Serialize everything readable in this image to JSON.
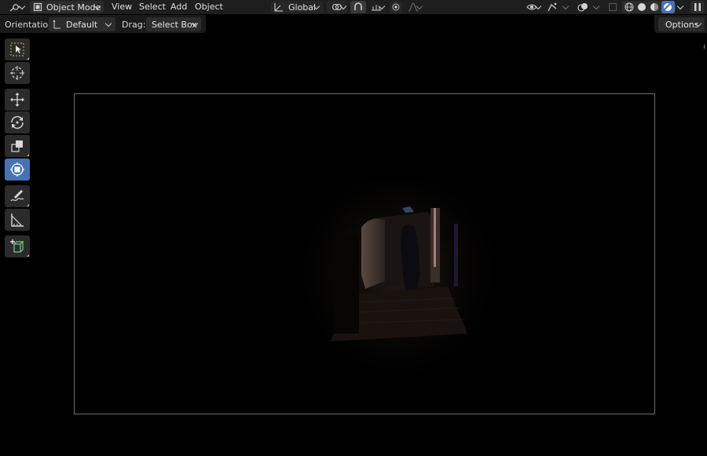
{
  "header": {
    "mode_label": "Object Mode",
    "menu": [
      "View",
      "Select",
      "Add",
      "Object"
    ],
    "transform_orientation": "Global"
  },
  "subheader": {
    "orientation_label": "Orientation:",
    "orientation_value": "Default",
    "drag_label": "Drag:",
    "drag_value": "Select Box",
    "options_label": "Options"
  },
  "toolbar": {
    "tools": [
      {
        "name": "select-box-icon",
        "active": false
      },
      {
        "name": "cursor-icon",
        "active": false
      },
      {
        "name": "move-icon",
        "active": false
      },
      {
        "name": "rotate-icon",
        "active": false
      },
      {
        "name": "scale-icon",
        "active": false
      },
      {
        "name": "transform-icon",
        "active": true
      },
      {
        "name": "annotate-icon",
        "active": false
      },
      {
        "name": "measure-icon",
        "active": false
      },
      {
        "name": "add-cube-icon",
        "active": false
      }
    ]
  },
  "colors": {
    "header_bg": "#1e1e1e",
    "button_bg": "#2c2c2c",
    "accent": "#4772b3",
    "viewport_bg": "#000000"
  }
}
